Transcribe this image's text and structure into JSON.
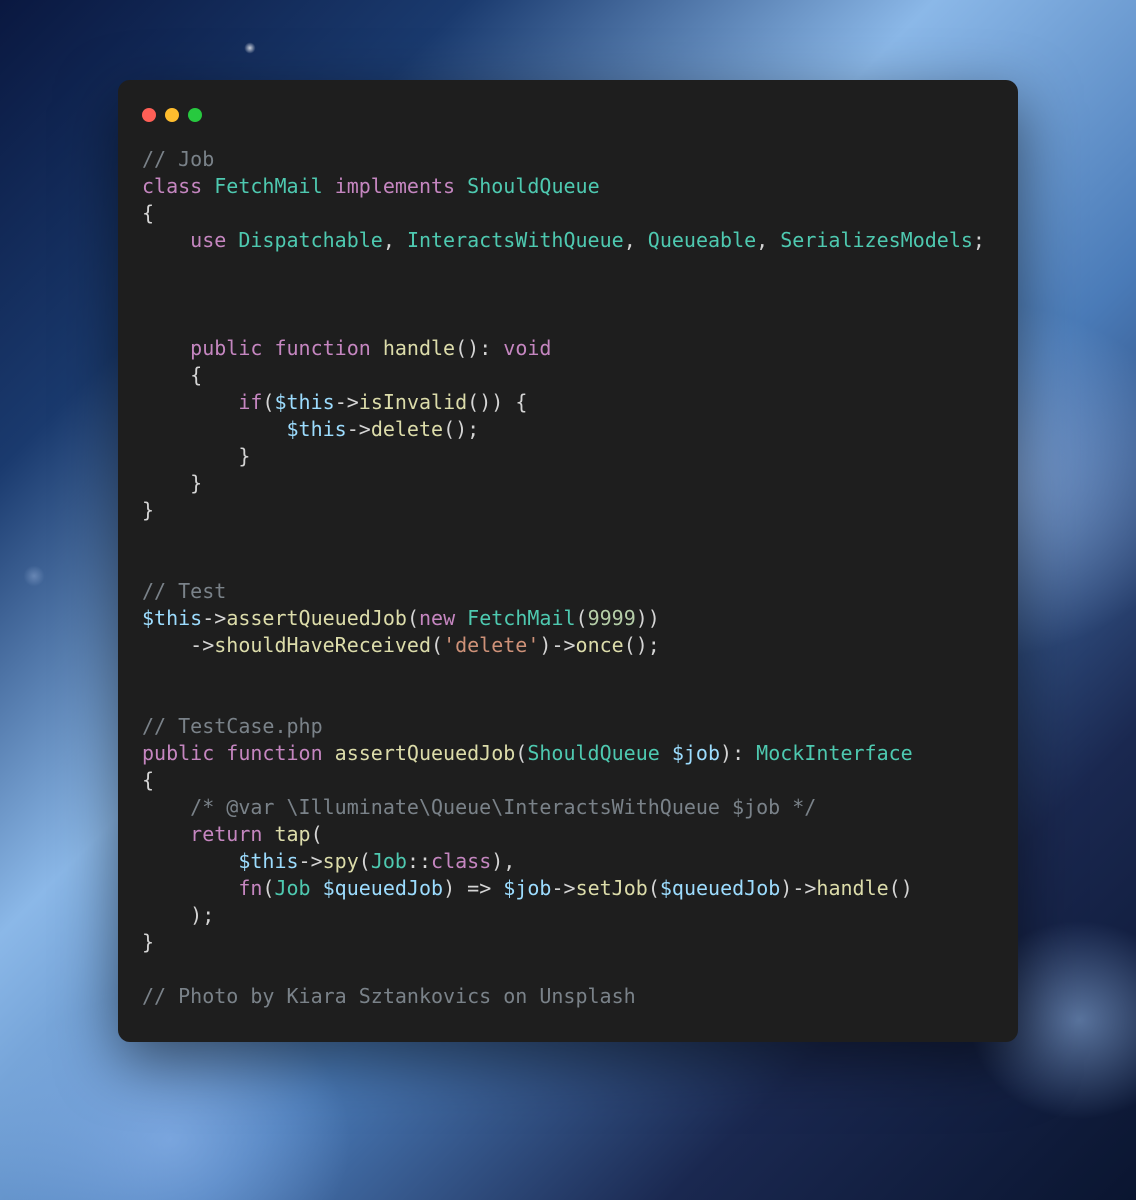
{
  "comments": {
    "job": "// Job",
    "test": "// Test",
    "testcase": "// TestCase.php",
    "docblock": "/* @var \\Illuminate\\Queue\\InteractsWithQueue $job */",
    "photo": "// Photo by Kiara Sztankovics on Unsplash"
  },
  "keywords": {
    "class": "class",
    "implements": "implements",
    "use": "use",
    "public": "public",
    "function": "function",
    "void": "void",
    "if": "if",
    "new": "new",
    "return": "return",
    "fn": "fn",
    "classConst": "class"
  },
  "types": {
    "FetchMail": "FetchMail",
    "ShouldQueue": "ShouldQueue",
    "Dispatchable": "Dispatchable",
    "InteractsWithQueue": "InteractsWithQueue",
    "Queueable": "Queueable",
    "SerializesModels": "SerializesModels",
    "MockInterface": "MockInterface",
    "Job": "Job"
  },
  "funcs": {
    "handle": "handle",
    "isInvalid": "isInvalid",
    "delete": "delete",
    "assertQueuedJob": "assertQueuedJob",
    "shouldHaveReceived": "shouldHaveReceived",
    "once": "once",
    "tap": "tap",
    "spy": "spy",
    "setJob": "setJob"
  },
  "vars": {
    "this": "$this",
    "job": "$job",
    "queuedJob": "$queuedJob"
  },
  "strings": {
    "delete": "'delete'"
  },
  "nums": {
    "n9999": "9999"
  },
  "punc": {
    "obrace": "{",
    "cbrace": "}",
    "oparen": "(",
    "cparen": ")",
    "arrow": "->",
    "fatArrow": "=>",
    "dcolon": "::",
    "comma": ",",
    "semi": ";",
    "colon": ":",
    "sp": " "
  }
}
